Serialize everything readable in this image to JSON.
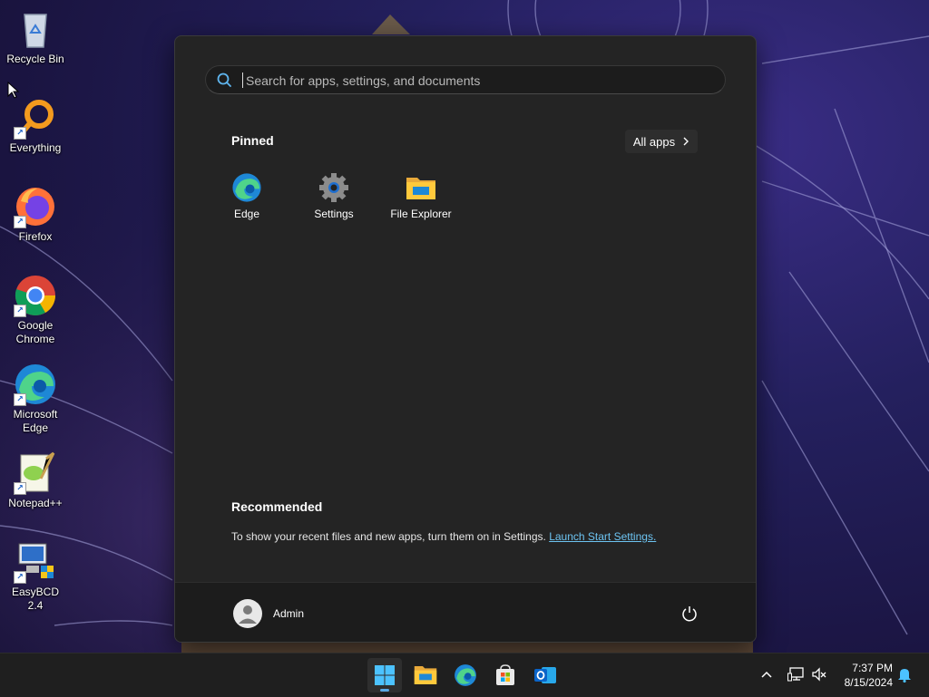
{
  "desktop": {
    "icons": [
      {
        "label": "Recycle Bin",
        "icon": "recycle-bin-icon"
      },
      {
        "label": "Everything",
        "icon": "magnifier-icon"
      },
      {
        "label": "Firefox",
        "icon": "firefox-icon"
      },
      {
        "label": "Google Chrome",
        "icon": "chrome-icon"
      },
      {
        "label": "Microsoft Edge",
        "icon": "edge-icon"
      },
      {
        "label": "Notepad++",
        "icon": "notepadpp-icon"
      },
      {
        "label": "EasyBCD 2.4",
        "icon": "easybcd-icon"
      }
    ]
  },
  "start_menu": {
    "search_placeholder": "Search for apps, settings, and documents",
    "pinned_title": "Pinned",
    "all_apps_label": "All apps",
    "pinned": [
      {
        "label": "Edge",
        "icon": "edge-icon"
      },
      {
        "label": "Settings",
        "icon": "gear-icon"
      },
      {
        "label": "File Explorer",
        "icon": "folder-icon"
      }
    ],
    "recommended_title": "Recommended",
    "recommended_text": "To show your recent files and new apps, turn them on in Settings.",
    "recommended_link": "Launch Start Settings.",
    "user_name": "Admin"
  },
  "taskbar": {
    "apps": [
      "start-icon",
      "file-explorer-icon",
      "edge-icon",
      "microsoft-store-icon",
      "outlook-icon"
    ],
    "tray": [
      "chevron-up-icon",
      "network-icon",
      "volume-muted-icon",
      "notification-bell-icon"
    ],
    "time": "7:37 PM",
    "date": "8/15/2024"
  },
  "colors": {
    "accent": "#5aa9e6",
    "link": "#6dc4f2",
    "start_bg": "#242424",
    "taskbar_bg": "#1f1f1f"
  }
}
